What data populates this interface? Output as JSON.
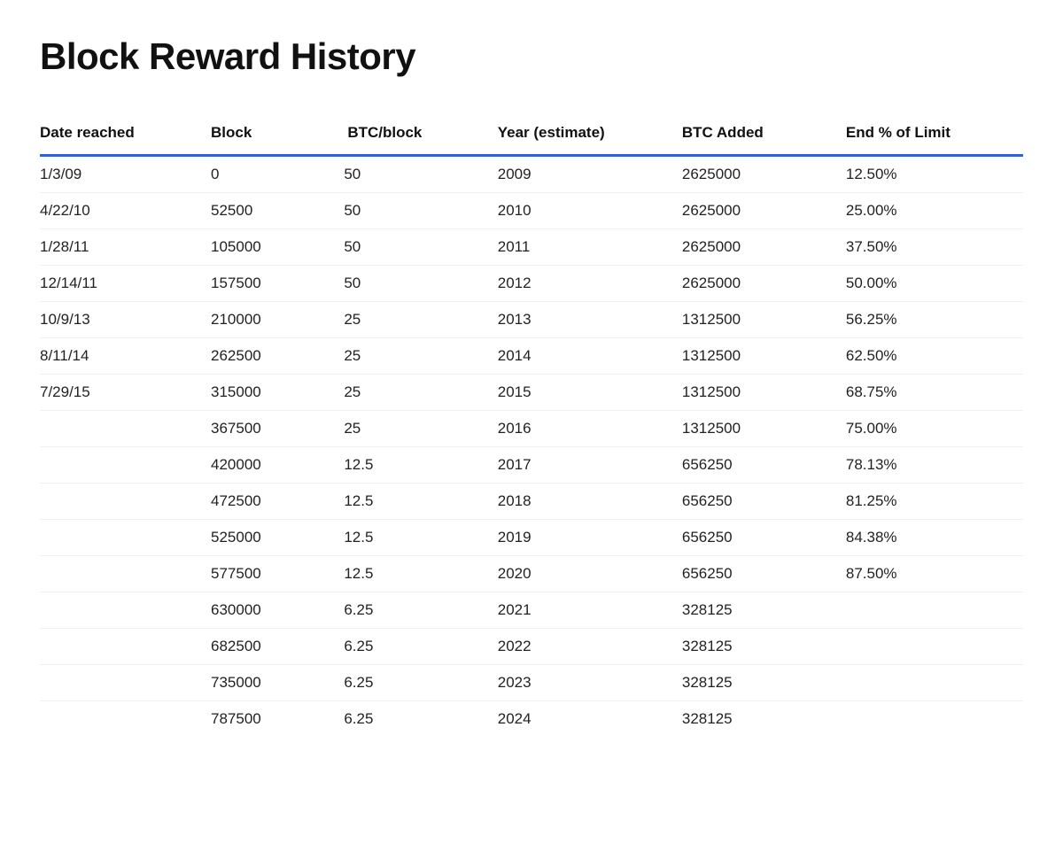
{
  "page": {
    "title": "Block Reward History"
  },
  "table": {
    "headers": {
      "date": "Date reached",
      "block": "Block",
      "btc_block": "BTC/block",
      "year": "Year (estimate)",
      "btc_added": "BTC Added",
      "end_limit": "End % of Limit"
    },
    "rows": [
      {
        "date": "1/3/09",
        "block": "0",
        "btc_block": "50",
        "year": "2009",
        "btc_added": "2625000",
        "end_limit": "12.50%"
      },
      {
        "date": "4/22/10",
        "block": "52500",
        "btc_block": "50",
        "year": "2010",
        "btc_added": "2625000",
        "end_limit": "25.00%"
      },
      {
        "date": "1/28/11",
        "block": "105000",
        "btc_block": "50",
        "year": "2011",
        "btc_added": "2625000",
        "end_limit": "37.50%"
      },
      {
        "date": "12/14/11",
        "block": "157500",
        "btc_block": "50",
        "year": "2012",
        "btc_added": "2625000",
        "end_limit": "50.00%"
      },
      {
        "date": "10/9/13",
        "block": "210000",
        "btc_block": "25",
        "year": "2013",
        "btc_added": "1312500",
        "end_limit": "56.25%"
      },
      {
        "date": "8/11/14",
        "block": "262500",
        "btc_block": "25",
        "year": "2014",
        "btc_added": "1312500",
        "end_limit": "62.50%"
      },
      {
        "date": "7/29/15",
        "block": "315000",
        "btc_block": "25",
        "year": "2015",
        "btc_added": "1312500",
        "end_limit": "68.75%"
      },
      {
        "date": "",
        "block": "367500",
        "btc_block": "25",
        "year": "2016",
        "btc_added": "1312500",
        "end_limit": "75.00%"
      },
      {
        "date": "",
        "block": "420000",
        "btc_block": "12.5",
        "year": "2017",
        "btc_added": "656250",
        "end_limit": "78.13%"
      },
      {
        "date": "",
        "block": "472500",
        "btc_block": "12.5",
        "year": "2018",
        "btc_added": "656250",
        "end_limit": "81.25%"
      },
      {
        "date": "",
        "block": "525000",
        "btc_block": "12.5",
        "year": "2019",
        "btc_added": "656250",
        "end_limit": "84.38%"
      },
      {
        "date": "",
        "block": "577500",
        "btc_block": "12.5",
        "year": "2020",
        "btc_added": "656250",
        "end_limit": "87.50%"
      },
      {
        "date": "",
        "block": "630000",
        "btc_block": "6.25",
        "year": "2021",
        "btc_added": "328125",
        "end_limit": ""
      },
      {
        "date": "",
        "block": "682500",
        "btc_block": "6.25",
        "year": "2022",
        "btc_added": "328125",
        "end_limit": ""
      },
      {
        "date": "",
        "block": "735000",
        "btc_block": "6.25",
        "year": "2023",
        "btc_added": "328125",
        "end_limit": ""
      },
      {
        "date": "",
        "block": "787500",
        "btc_block": "6.25",
        "year": "2024",
        "btc_added": "328125",
        "end_limit": ""
      }
    ]
  }
}
